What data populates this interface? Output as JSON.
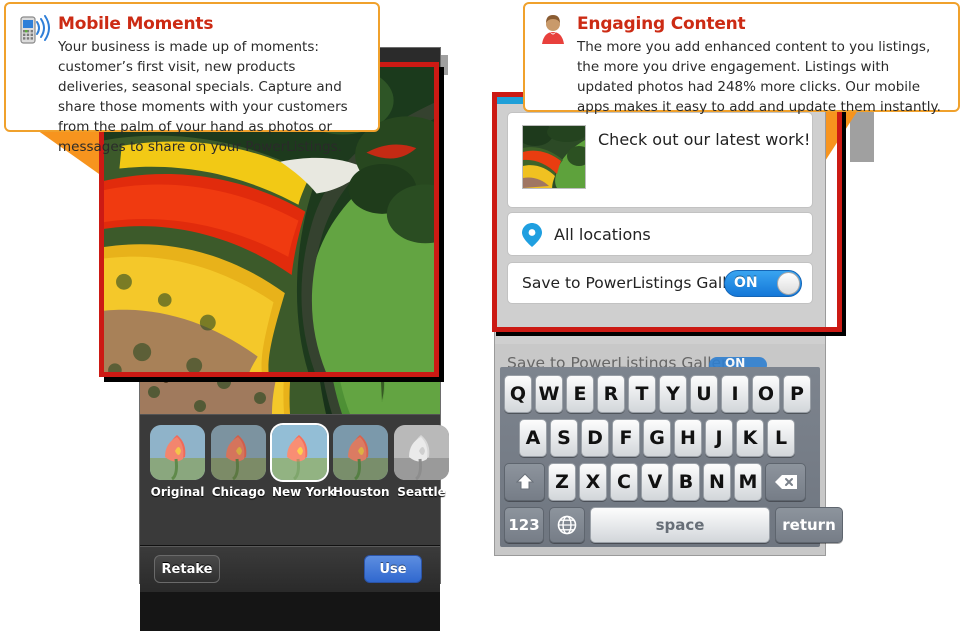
{
  "callouts": [
    {
      "id": "mobile-moments",
      "icon": "mobile-phone-signal-icon",
      "title": "Mobile Moments",
      "body": "Your business is made up of moments: customer’s first visit, new products deliveries, seasonal specials. Capture and share those moments with your customers from the palm of your hand as photos or messages to share on your PowerListings."
    },
    {
      "id": "engaging-content",
      "icon": "person-avatar-icon",
      "title": "Engaging Content",
      "body": "The more you add enhanced content to you listings, the more you drive engagement. Listings with updated photos had 248% more clicks. Our mobile apps makes it easy to add and update them instantly."
    }
  ],
  "left_phone": {
    "filters": [
      {
        "label": "Original",
        "selected": false
      },
      {
        "label": "Chicago",
        "selected": false
      },
      {
        "label": "New York",
        "selected": true
      },
      {
        "label": "Houston",
        "selected": false
      },
      {
        "label": "Seattle",
        "selected": false
      }
    ],
    "retake_label": "Retake",
    "use_label": "Use"
  },
  "right_phone": {
    "message_text": "Check out our latest work!",
    "location_label": "All locations",
    "location_icon": "map-pin-icon",
    "save_label": "Save to PowerListings Gallery",
    "toggle_state": "ON",
    "ghost_save_label": "Save to PowerListings Gallery",
    "ghost_toggle_state": "ON",
    "keyboard": {
      "row1": [
        "Q",
        "W",
        "E",
        "R",
        "T",
        "Y",
        "U",
        "I",
        "O",
        "P"
      ],
      "row2": [
        "A",
        "S",
        "D",
        "F",
        "G",
        "H",
        "J",
        "K",
        "L"
      ],
      "row3_shift": "shift-icon",
      "row3": [
        "Z",
        "X",
        "C",
        "V",
        "B",
        "N",
        "M"
      ],
      "row3_backspace": "backspace-icon",
      "numbers_key": "123",
      "globe_key": "globe-icon",
      "space_key": "space",
      "return_key": "return"
    }
  },
  "colors": {
    "callout_border": "#f0a12c",
    "callout_title": "#cc2b14",
    "highlight_frame": "#cc1a14",
    "accent_blue": "#1477d8",
    "use_button": "#3068cf",
    "status_bar": "#1f9fd8"
  }
}
